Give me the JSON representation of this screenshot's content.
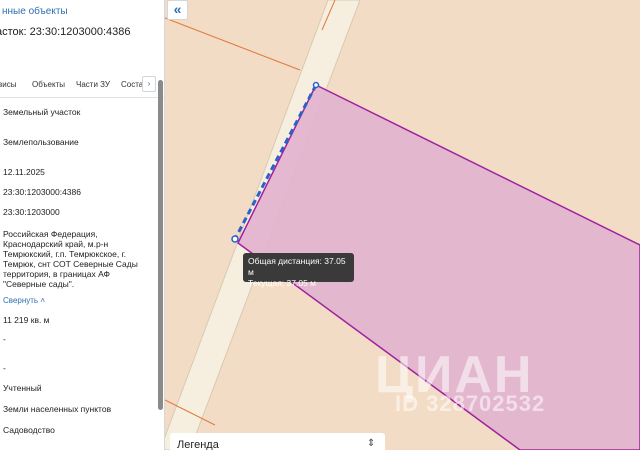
{
  "panel": {
    "back_link": "нные объекты",
    "title": "асток: 23:30:1203000:4386",
    "tabs": [
      "висы",
      "Объекты",
      "Части ЗУ",
      "Соста"
    ],
    "tab_next": "›",
    "rows": {
      "type": "Земельный участок",
      "usage": "Землепользование",
      "date": "12.11.2025",
      "cad_number": "23:30:1203000:4386",
      "quarter": "23:30:1203000",
      "address": "Российская Федерация, Краснодарский край, м.р-н Темрюкский, г.п. Темрюкское, г. Темрюк, снт СОТ Северные Сады территория, в границах АФ \"Северные сады\".",
      "collapse": "Свернуть",
      "area": "11 219 кв. м",
      "dash1": "-",
      "dash2": "-",
      "status": "Учтенный",
      "category": "Земли населенных пунктов",
      "permitted_use": "Садоводство"
    }
  },
  "collapse_button": "«",
  "tooltip": {
    "total": "Общая дистанция: 37.05 м",
    "current": "Текущая: 37.05 м"
  },
  "legend": {
    "label": "Легенда",
    "caret": "⇕"
  },
  "watermark": {
    "logo": "ЦИАН",
    "id": "ID 328702532"
  },
  "colors": {
    "map_bg": "#f3dcc6",
    "road": "#f6efdf",
    "parcel_fill": "#e2b4cf",
    "parcel_border": "#a020a0",
    "measure_line": "#2a62c8",
    "accent": "#2c6fb3"
  }
}
